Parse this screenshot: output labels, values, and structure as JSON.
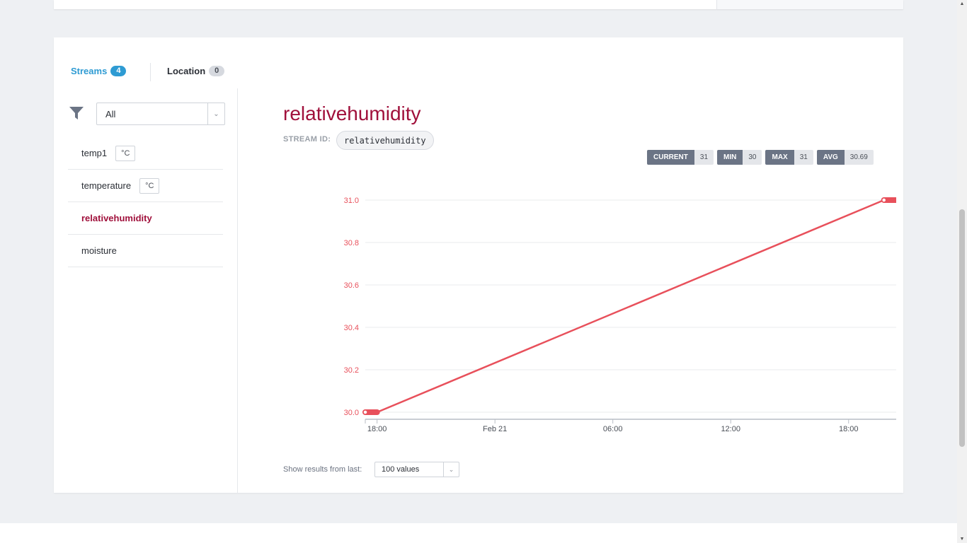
{
  "tabs": {
    "streams": {
      "label": "Streams",
      "count": "4"
    },
    "location": {
      "label": "Location",
      "count": "0"
    }
  },
  "filter": {
    "selected": "All"
  },
  "streams": [
    {
      "name": "temp1",
      "unit": "°C",
      "active": false
    },
    {
      "name": "temperature",
      "unit": "°C",
      "active": false
    },
    {
      "name": "relativehumidity",
      "unit": "",
      "active": true
    },
    {
      "name": "moisture",
      "unit": "",
      "active": false
    }
  ],
  "detail": {
    "title": "relativehumidity",
    "stream_id_label": "STREAM ID:",
    "stream_id": "relativehumidity",
    "stats": [
      {
        "key": "CURRENT",
        "value": "31"
      },
      {
        "key": "MIN",
        "value": "30"
      },
      {
        "key": "MAX",
        "value": "31"
      },
      {
        "key": "AVG",
        "value": "30.69"
      }
    ],
    "show_label": "Show results from last:",
    "show_selected": "100 values"
  },
  "colors": {
    "accent": "#a0103b",
    "line": "#e8505b",
    "tab_active": "#2e9bd3"
  },
  "chart_data": {
    "type": "line",
    "series": [
      {
        "points": [
          [
            0,
            30.0
          ],
          [
            0.1,
            30.0
          ],
          [
            4.4,
            31.0
          ],
          [
            4.6,
            31.0
          ]
        ]
      }
    ],
    "xlim": [
      0,
      4.6
    ],
    "ylim": [
      30.0,
      31.0
    ],
    "yticks": [
      {
        "v": 31.0,
        "label": "31.0"
      },
      {
        "v": 30.8,
        "label": "30.8"
      },
      {
        "v": 30.6,
        "label": "30.6"
      },
      {
        "v": 30.4,
        "label": "30.4"
      },
      {
        "v": 30.2,
        "label": "30.2"
      },
      {
        "v": 30.0,
        "label": "30.0"
      }
    ],
    "xticks": [
      {
        "v": 0.1,
        "label": "18:00"
      },
      {
        "v": 1.1,
        "label": "Feb 21"
      },
      {
        "v": 2.1,
        "label": "06:00"
      },
      {
        "v": 3.1,
        "label": "12:00"
      },
      {
        "v": 4.1,
        "label": "18:00"
      }
    ],
    "grid": true
  }
}
